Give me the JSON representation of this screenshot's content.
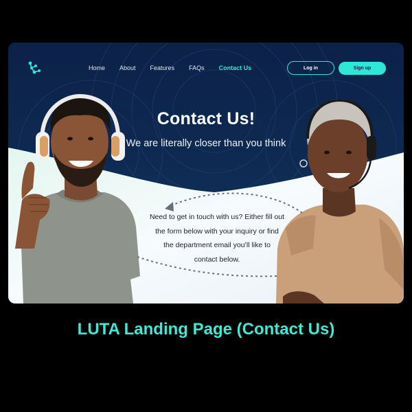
{
  "brand": {
    "logo_icon": "luta-molecule-icon",
    "accent": "#2ee8d6"
  },
  "nav": {
    "items": [
      {
        "label": "Home",
        "active": false
      },
      {
        "label": "About",
        "active": false
      },
      {
        "label": "Features",
        "active": false
      },
      {
        "label": "FAQs",
        "active": false
      },
      {
        "label": "Contact Us",
        "active": true
      }
    ]
  },
  "auth": {
    "login_label": "Log in",
    "signup_label": "Sign up"
  },
  "hero": {
    "title": "Contact Us!",
    "subtitle": "We are literally closer than you think"
  },
  "body": {
    "lines": [
      "Need to get in touch with us? Either fill out",
      "the form below with your inquiry or find",
      "the department email you’ll like to",
      "contact below."
    ]
  },
  "images": {
    "left_person": "man-with-headphones-thumbs-up",
    "right_person": "woman-with-headset"
  },
  "caption": "LUTA Landing Page (Contact Us)"
}
